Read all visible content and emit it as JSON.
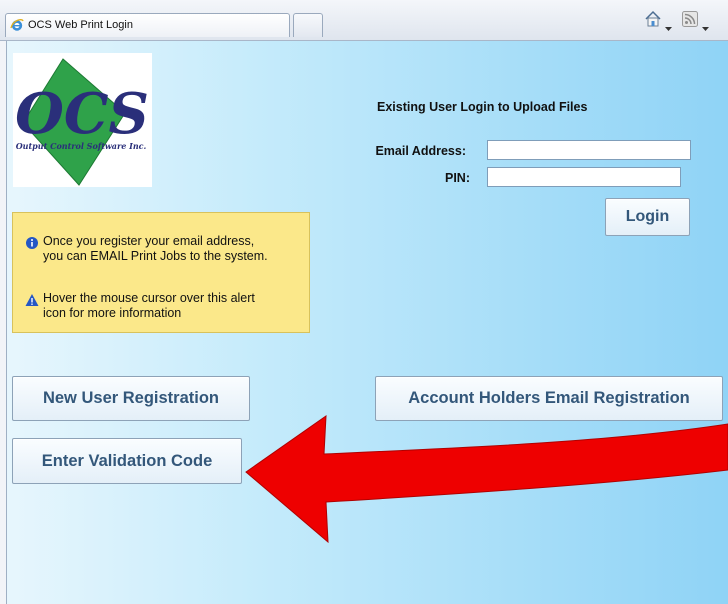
{
  "browser": {
    "tab_title": "OCS Web Print Login",
    "icons": [
      "ie-icon",
      "home-icon",
      "dropdown-arrow-icon",
      "rss-feed-icon"
    ]
  },
  "logo": {
    "letters": "OCS",
    "company": "Output Control Software Inc."
  },
  "notice": {
    "info_text_line1": "Once you register your email address,",
    "info_text_line2": "you can EMAIL Print Jobs to the system.",
    "alert_text_line1": "Hover the mouse cursor over this alert",
    "alert_text_line2": "icon for more information"
  },
  "login": {
    "title": "Existing User Login to Upload Files",
    "email_label": "Email Address:",
    "email_value": "",
    "pin_label": "PIN:",
    "pin_value": "",
    "login_button": "Login"
  },
  "buttons": {
    "new_user": "New User Registration",
    "account_holders": "Account Holders Email Registration",
    "validation": "Enter Validation Code"
  },
  "colors": {
    "accent_text": "#33577a",
    "notice_bg": "#fbe88a",
    "arrow": "#e80000"
  }
}
